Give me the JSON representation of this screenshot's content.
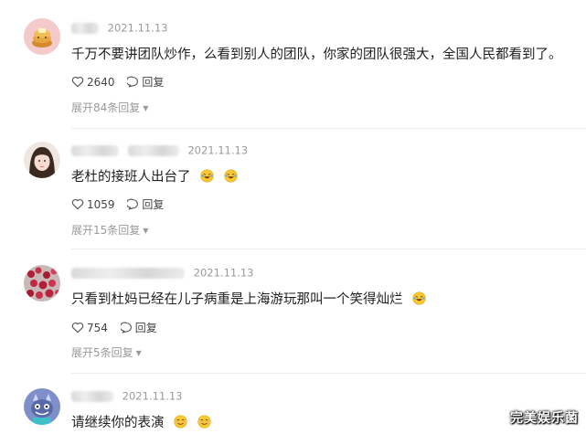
{
  "comments": [
    {
      "timestamp": "2021.11.13",
      "text": "千万不要讲团队炒作，么看到别人的团队，你家的团队很强大，全国人民都看到了。",
      "likes": "2640",
      "reply_label": "回复",
      "expand_label": "展开84条回复",
      "avatar_icon": "pancake-avatar-icon",
      "emojis": []
    },
    {
      "timestamp": "2021.11.13",
      "text": "老杜的接班人出台了",
      "likes": "1059",
      "reply_label": "回复",
      "expand_label": "展开15条回复",
      "avatar_icon": "girl-avatar-icon",
      "emojis": [
        "rofl-emoji-icon",
        "rofl-emoji-icon"
      ]
    },
    {
      "timestamp": "2021.11.13",
      "text": "只看到杜妈已经在儿子病重是上海游玩那叫一个笑得灿烂",
      "likes": "754",
      "reply_label": "回复",
      "expand_label": "展开5条回复",
      "avatar_icon": "red-berries-avatar-icon",
      "emojis": [
        "rofl-emoji-icon"
      ]
    },
    {
      "timestamp": "2021.11.13",
      "text": "请继续你的表演",
      "avatar_icon": "monster-avatar-icon",
      "emojis": [
        "smirk-emoji-icon",
        "smirk-emoji-icon"
      ]
    }
  ],
  "watermark": "完美娱乐菌",
  "colors": {
    "meta": "#9a9a9a",
    "text": "#1e1e1e",
    "divider": "#eeeeee"
  }
}
